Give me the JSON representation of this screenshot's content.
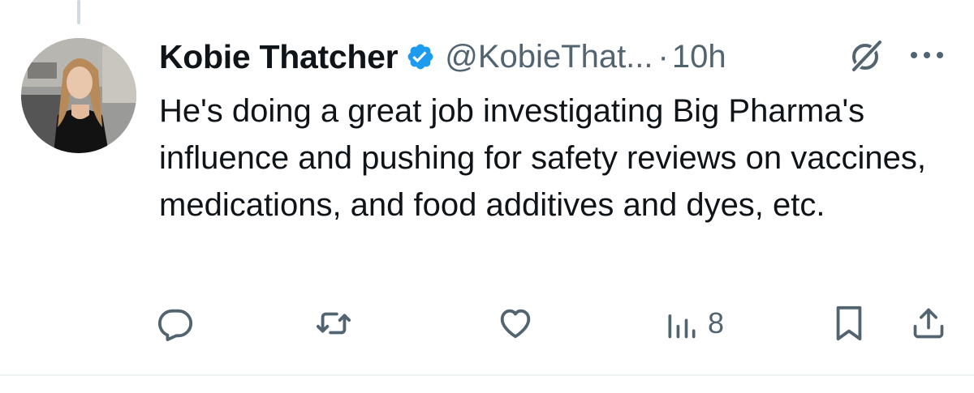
{
  "tweet": {
    "display_name": "Kobie Thatcher",
    "handle": "@KobieThat...",
    "separator": "·",
    "time": "10h",
    "text": "He's doing a great job investigating Big Pharma's influence and pushing for safety reviews on vaccines, medications, and food additives and dyes, etc.",
    "verified": true
  },
  "actions": {
    "reply_icon": "reply-icon",
    "repost_icon": "repost-icon",
    "like_icon": "heart-icon",
    "views_icon": "views-icon",
    "views_count": "8",
    "bookmark_icon": "bookmark-icon",
    "share_icon": "share-icon"
  },
  "colors": {
    "text_primary": "#0f1419",
    "text_secondary": "#536471",
    "verified_blue": "#1d9bf0",
    "divider": "#eff3f4",
    "thread_line": "#cfd9de"
  }
}
